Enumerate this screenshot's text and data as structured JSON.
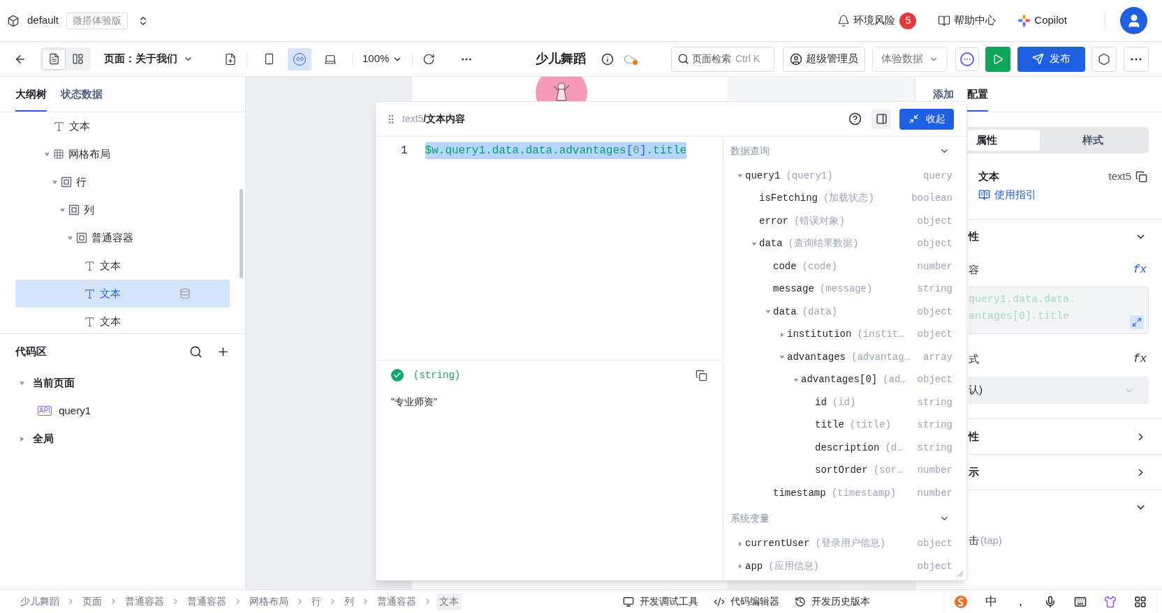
{
  "header": {
    "project": "default",
    "edition": "微搭体验版",
    "risk": {
      "label": "环境风险",
      "count": "5"
    },
    "help": "帮助中心",
    "copilot": "Copilot"
  },
  "toolbar": {
    "views": [
      {
        "selected": true
      },
      {
        "selected": false
      }
    ],
    "page": "页面：关于我们",
    "devices": [
      {
        "kind": "phone",
        "selected": false
      },
      {
        "kind": "adaptive",
        "selected": true
      },
      {
        "kind": "desktop",
        "selected": false
      }
    ],
    "zoom": "100%",
    "title": "少儿舞蹈",
    "search": {
      "label": "页面检索",
      "shortcut": "Ctrl K"
    },
    "role": "超级管理员",
    "data_source": "体验数据",
    "publish": "发布"
  },
  "left_panel": {
    "tabs": [
      {
        "label": "大纲树",
        "selected": true
      },
      {
        "label": "状态数据",
        "selected": false
      }
    ],
    "outline": [
      {
        "kind": "text",
        "label": "文本",
        "selected": false,
        "bound": false
      },
      {
        "kind": "grid",
        "label": "网格布局",
        "selected": false,
        "bound": false,
        "expanded": true,
        "children": [
          {
            "kind": "container",
            "label": "行",
            "selected": false,
            "bound": false,
            "expanded": true,
            "children": [
              {
                "kind": "container",
                "label": "列",
                "selected": false,
                "bound": false,
                "expanded": true,
                "children": [
                  {
                    "kind": "container",
                    "label": "普通容器",
                    "selected": false,
                    "bound": false,
                    "expanded": true,
                    "children": [
                      {
                        "kind": "text",
                        "label": "文本",
                        "selected": false,
                        "bound": false
                      },
                      {
                        "kind": "text",
                        "label": "文本",
                        "selected": true,
                        "bound": true
                      },
                      {
                        "kind": "text",
                        "label": "文本",
                        "selected": false,
                        "bound": false
                      }
                    ]
                  }
                ]
              }
            ]
          }
        ]
      }
    ],
    "code_area": {
      "title": "代码区",
      "items": [
        {
          "kind": "group",
          "label": "当前页面",
          "expanded": true,
          "children": [
            {
              "kind": "api",
              "badge": "API",
              "label": "query1"
            }
          ]
        },
        {
          "kind": "group",
          "label": "全局",
          "expanded": false
        }
      ]
    }
  },
  "editor": {
    "component": "text5",
    "title": "/文本内容",
    "collapse": "收起",
    "line_number": "1",
    "code": [
      {
        "kind": "ident",
        "text": "$w.query1.data.data.advantages"
      },
      {
        "kind": "bracket",
        "text": "["
      },
      {
        "kind": "number",
        "text": "0"
      },
      {
        "kind": "bracket",
        "text": "]"
      },
      {
        "kind": "ident",
        "text": ".title"
      }
    ],
    "result": {
      "ok": true,
      "type": "(string)",
      "value": "\"专业师资\""
    },
    "sections": [
      {
        "title": "数据查询",
        "expanded": true,
        "items": [
          {
            "name": "query1",
            "desc": "(query1)",
            "type": "query",
            "expanded": true,
            "children": [
              {
                "name": "isFetching",
                "desc": "(加载状态)",
                "type": "boolean"
              },
              {
                "name": "error",
                "desc": "(错误对象)",
                "type": "object"
              },
              {
                "name": "data",
                "desc": "(查询结果数据)",
                "type": "object",
                "expanded": true,
                "children": [
                  {
                    "name": "code",
                    "desc": "(code)",
                    "type": "number"
                  },
                  {
                    "name": "message",
                    "desc": "(message)",
                    "type": "string"
                  },
                  {
                    "name": "data",
                    "desc": "(data)",
                    "type": "object",
                    "expanded": true,
                    "children": [
                      {
                        "name": "institution",
                        "desc": "(instit…",
                        "type": "object",
                        "expanded": false
                      },
                      {
                        "name": "advantages",
                        "desc": "(advantag…",
                        "type": "array",
                        "expanded": true,
                        "children": [
                          {
                            "name": "advantages[0]",
                            "desc": "(ad…",
                            "type": "object",
                            "expanded": true,
                            "children": [
                              {
                                "name": "id",
                                "desc": "(id)",
                                "type": "string"
                              },
                              {
                                "name": "title",
                                "desc": "(title)",
                                "type": "string"
                              },
                              {
                                "name": "description",
                                "desc": "(d…",
                                "type": "string"
                              },
                              {
                                "name": "sortOrder",
                                "desc": "(sor…",
                                "type": "number"
                              }
                            ]
                          }
                        ]
                      }
                    ]
                  },
                  {
                    "name": "timestamp",
                    "desc": "(timestamp)",
                    "type": "number"
                  }
                ]
              }
            ]
          }
        ]
      },
      {
        "title": "系统变量",
        "expanded": true,
        "items": [
          {
            "name": "currentUser",
            "desc": "(登录用户信息)",
            "type": "object",
            "expanded": false
          },
          {
            "name": "app",
            "desc": "(应用信息)",
            "type": "object",
            "expanded": false
          }
        ]
      }
    ]
  },
  "right_panel": {
    "tabs": [
      {
        "label": "添加",
        "selected": false
      },
      {
        "label": "配置",
        "selected": true
      }
    ],
    "modes": [
      {
        "label": "属性",
        "selected": true
      },
      {
        "label": "样式",
        "selected": false
      }
    ],
    "component": {
      "name": "文本",
      "id": "text5",
      "guide": "使用指引"
    },
    "sections": [
      {
        "title": "性",
        "expanded": true,
        "fields": [
          {
            "kind": "code",
            "label": "容",
            "formula": "fx",
            "bound": true,
            "lines": [
              "query1.data.data.",
              "antages[0].title"
            ]
          },
          {
            "kind": "select",
            "label": "式",
            "formula": "fx",
            "bound": false,
            "value": "认)"
          }
        ]
      },
      {
        "title": "性",
        "expanded": false
      },
      {
        "title": "示",
        "expanded": false
      },
      {
        "expanded": true,
        "fields": [
          {
            "kind": "event",
            "label": "击",
            "hint": "(tap)"
          }
        ]
      }
    ]
  },
  "breadcrumb": [
    {
      "label": "少儿舞蹈",
      "selected": false
    },
    {
      "label": "页面",
      "selected": false
    },
    {
      "label": "普通容器",
      "selected": false
    },
    {
      "label": "普通容器",
      "selected": false
    },
    {
      "label": "网格布局",
      "selected": false
    },
    {
      "label": "行",
      "selected": false
    },
    {
      "label": "列",
      "selected": false
    },
    {
      "label": "普通容器",
      "selected": false
    },
    {
      "label": "文本",
      "selected": true
    }
  ],
  "bottom_tools": [
    {
      "kind": "debug",
      "label": "开发调试工具"
    },
    {
      "kind": "code",
      "label": "代码编辑器"
    },
    {
      "kind": "history",
      "label": "开发历史版本"
    }
  ],
  "ime": {
    "mode": "中",
    "punctuation": "，"
  }
}
